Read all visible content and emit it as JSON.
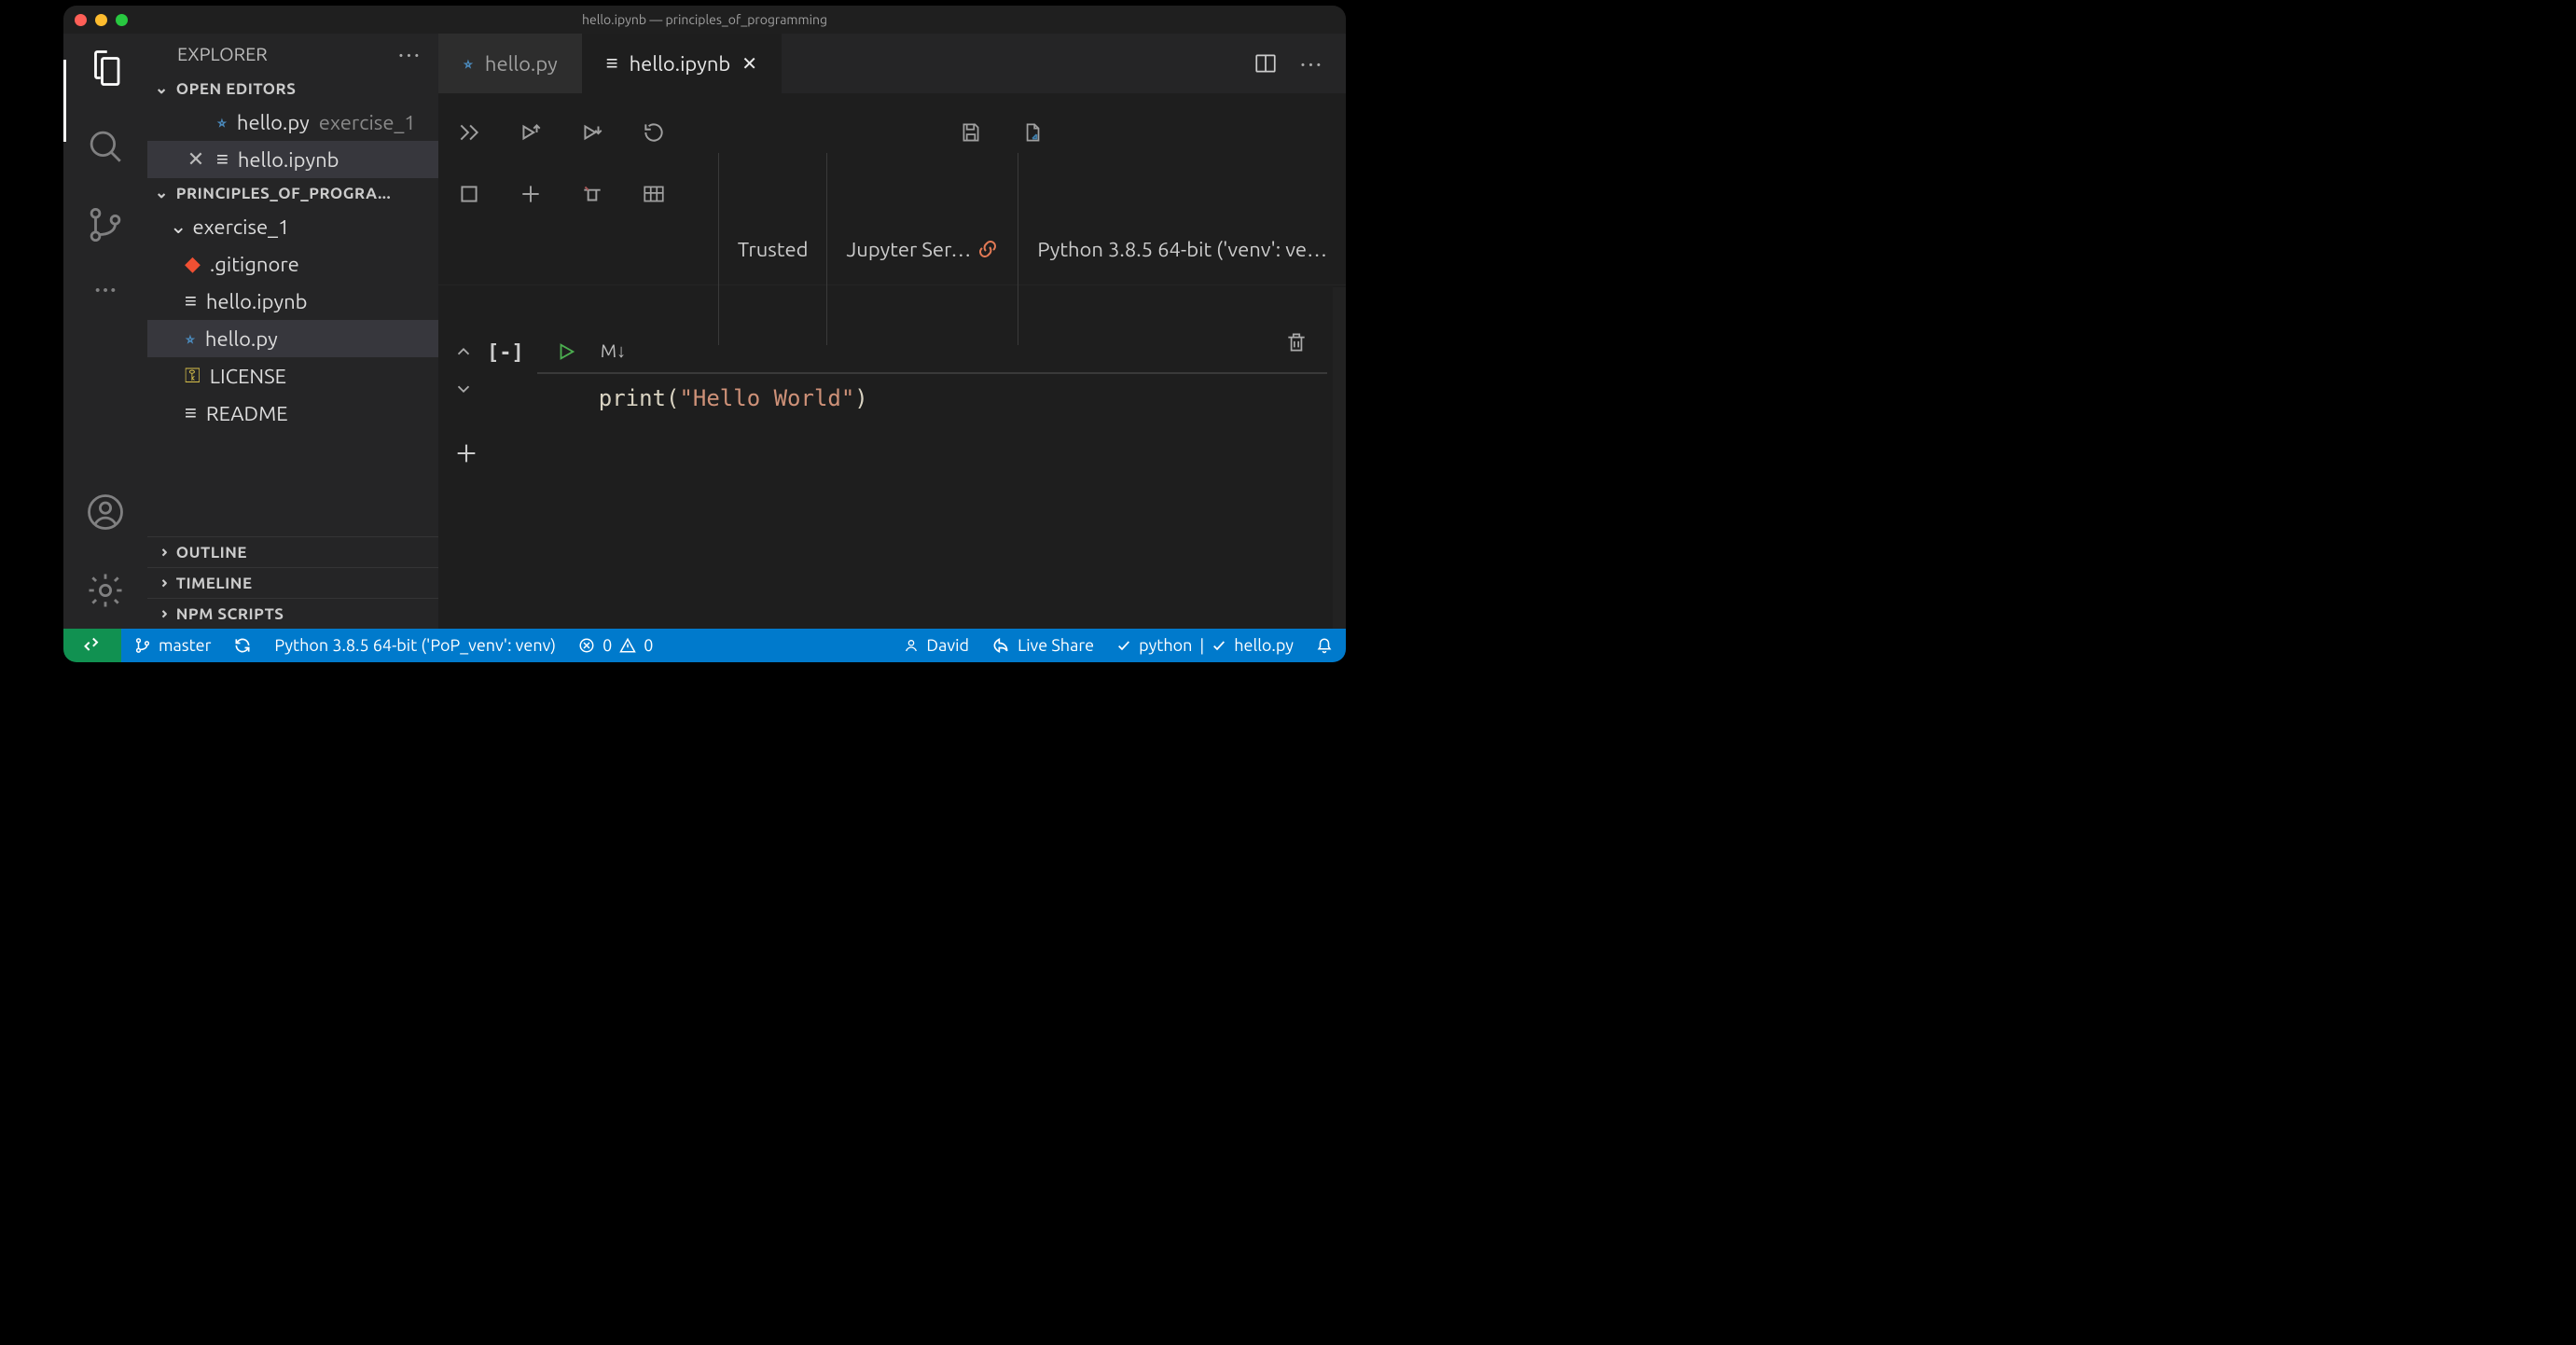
{
  "window": {
    "title": "hello.ipynb — principles_of_programming"
  },
  "sidebar": {
    "header": "EXPLORER",
    "openEditors": {
      "title": "OPEN EDITORS",
      "items": [
        {
          "name": "hello.py",
          "desc": "exercise_1",
          "icon": "python"
        },
        {
          "name": "hello.ipynb",
          "desc": "",
          "icon": "notebook",
          "close": true
        }
      ]
    },
    "workspace": {
      "title": "PRINCIPLES_OF_PROGRA...",
      "folder": "exercise_1",
      "files": [
        {
          "name": ".gitignore",
          "icon": "git"
        },
        {
          "name": "hello.ipynb",
          "icon": "notebook"
        },
        {
          "name": "hello.py",
          "icon": "python",
          "selected": true
        },
        {
          "name": "LICENSE",
          "icon": "key"
        },
        {
          "name": "README",
          "icon": "notebook"
        }
      ]
    },
    "collapsed": [
      "OUTLINE",
      "TIMELINE",
      "NPM SCRIPTS"
    ]
  },
  "tabs": [
    {
      "label": "hello.py",
      "icon": "python"
    },
    {
      "label": "hello.ipynb",
      "icon": "notebook",
      "active": true,
      "close": true
    }
  ],
  "toolbar": {
    "trusted": "Trusted",
    "server": "Jupyter Ser…",
    "kernel": "Python 3.8.5 64-bit ('venv': ve…"
  },
  "cell": {
    "markdownBtn": "M↓",
    "collapse": "[-]",
    "code": {
      "fn": "print",
      "str": "\"Hello World\""
    }
  },
  "status": {
    "branch": "master",
    "interpreter": "Python 3.8.5 64-bit ('PoP_venv': venv)",
    "errors": "0",
    "warnings": "0",
    "user": "David",
    "liveshare": "Live Share",
    "lang": "python",
    "file": "hello.py"
  }
}
